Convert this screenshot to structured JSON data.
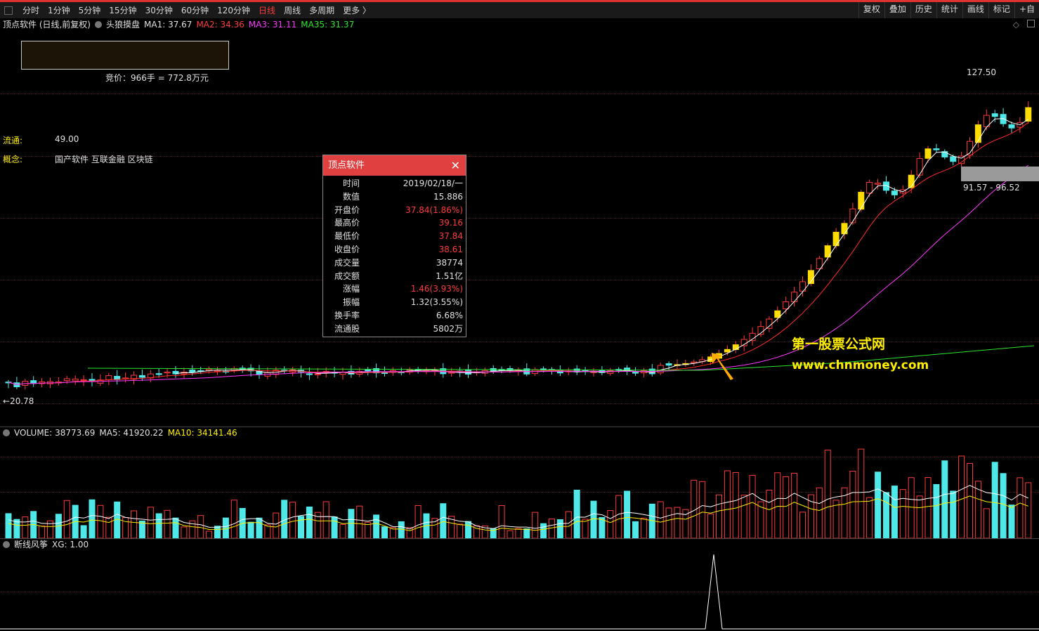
{
  "toolbar": {
    "periods": [
      "分时",
      "1分钟",
      "5分钟",
      "15分钟",
      "30分钟",
      "60分钟",
      "120分钟",
      "日线",
      "周线",
      "多周期",
      "更多 〉"
    ],
    "active_period": "日线",
    "right_tools": [
      "复权",
      "叠加",
      "历史",
      "统计",
      "画线",
      "标记",
      "+自"
    ]
  },
  "header": {
    "stock": "顶点软件 (日线,前复权)",
    "indicator": "头狼摸盘",
    "ma1": "MA1: 37.67",
    "ma2": "MA2: 34.36",
    "ma3": "MA3: 31.11",
    "ma35": "MA35: 31.37"
  },
  "bid_text": "竞价：966手 = 772.8万元",
  "float_label": "流通:",
  "float_value": "49.00",
  "concept_label": "概念:",
  "concept_value": "国产软件 互联金融 区块链",
  "popup": {
    "title": "顶点软件",
    "rows": [
      {
        "k": "时间",
        "v": "2019/02/18/一",
        "red": false
      },
      {
        "k": "数值",
        "v": "15.886",
        "red": false
      },
      {
        "k": "开盘价",
        "v": "37.84(1.86%)",
        "red": true
      },
      {
        "k": "最高价",
        "v": "39.16",
        "red": true
      },
      {
        "k": "最低价",
        "v": "37.84",
        "red": true
      },
      {
        "k": "收盘价",
        "v": "38.61",
        "red": true
      },
      {
        "k": "成交量",
        "v": "38774",
        "red": false
      },
      {
        "k": "成交额",
        "v": "1.51亿",
        "red": false
      },
      {
        "k": "涨幅",
        "v": "1.46(3.93%)",
        "red": true
      },
      {
        "k": "振幅",
        "v": "1.32(3.55%)",
        "red": false
      },
      {
        "k": "换手率",
        "v": "6.68%",
        "red": false
      },
      {
        "k": "流通股",
        "v": "5802万",
        "red": false
      }
    ]
  },
  "watermark_cn": "第一股票公式网",
  "watermark_url": "www.chnmoney.com",
  "high_label": "127.50",
  "range_label": "91.57 - 96.52",
  "low_label": "20.78",
  "volume_header": {
    "title": "VOLUME: 38773.69",
    "ma5": "MA5: 41920.22",
    "ma10": "MA10: 34141.46"
  },
  "signal_header": {
    "title": "断线风筝",
    "xg": "XG: 1.00"
  },
  "colors": {
    "up": "#ff3b3b",
    "down": "#4ee8e8",
    "limit_up": "#ffdd00",
    "ma1": "#ffffff",
    "ma2": "#ff2a2a",
    "ma3": "#ff38ff",
    "ma35": "#2ee82e"
  },
  "chart_data": {
    "type": "candlestick",
    "ylim": [
      20.78,
      127.5
    ],
    "signal_count": 1,
    "note_points": {
      "high": 127.5,
      "low": 20.78
    }
  }
}
